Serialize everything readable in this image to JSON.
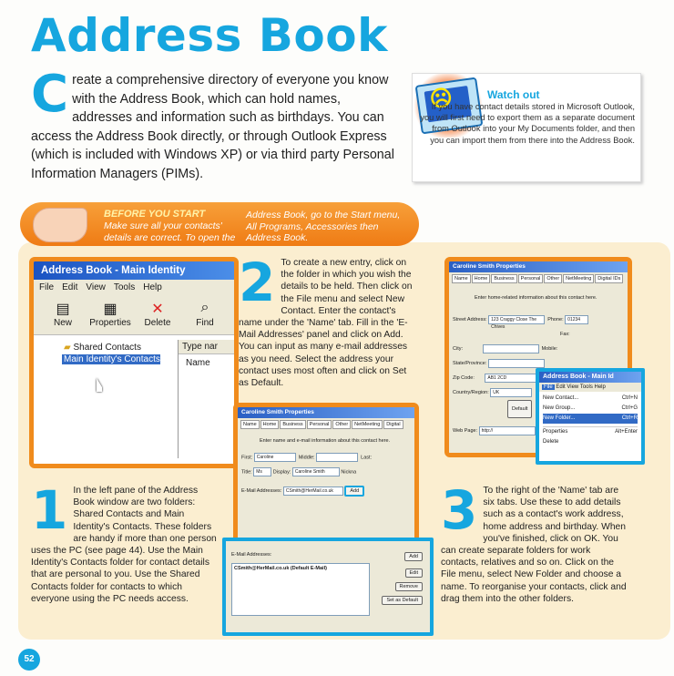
{
  "title": "Address Book",
  "intro": {
    "dropcap": "C",
    "text": "reate a comprehensive directory of everyone you know with the Address Book, which can hold names, addresses and information such as birthdays. You can access the Address Book directly, or through Outlook Express (which is included with Windows XP) or via third party Personal Information Managers (PIMs)."
  },
  "watch_out": {
    "title": "Watch out",
    "text": "If you have contact details stored in Microsoft Outlook, you will first need to export them as a separate document from Outlook into your My Documents folder, and then you can import them from there into the Address Book."
  },
  "before_you_start": {
    "heading": "BEFORE YOU START",
    "text_left": "Make sure all your contacts' details are correct. To open the",
    "text_right": "Address Book, go to the Start menu, All Programs, Accessories then Address Book."
  },
  "screenshot1": {
    "window_title": "Address Book - Main Identity",
    "menu": [
      "File",
      "Edit",
      "View",
      "Tools",
      "Help"
    ],
    "tools": [
      "New",
      "Properties",
      "Delete",
      "Find"
    ],
    "tree": [
      "Shared Contacts",
      "Main Identity's Contacts"
    ],
    "col_type": "Type nar",
    "col_name": "Name"
  },
  "step1": {
    "number": "1",
    "text": "In the left pane of the Address Book window are two folders: Shared Contacts and Main Identity's Contacts. These folders are handy if more than one person uses the PC (see page 44). Use the Main Identity's Contacts folder for contact details that are personal to you. Use the Shared Contacts folder for contacts to which everyone using the PC needs access."
  },
  "step2": {
    "number": "2",
    "text": "To create a new entry, click on the folder in which you wish the details to be held. Then click on the File menu and select New Contact. Enter the contact's name under the 'Name' tab. Fill in the 'E-Mail Addresses' panel and click on Add. You can input as many e-mail addresses as you need. Select the address your contact uses most often and click on Set as Default."
  },
  "screenshot2": {
    "window_title": "Caroline Smith Properties",
    "tabs": [
      "Name",
      "Home",
      "Business",
      "Personal",
      "Other",
      "NetMeeting",
      "Digital"
    ],
    "instruction": "Enter name and e-mail information about this contact here.",
    "first_label": "First:",
    "first_value": "Caroline",
    "middle_label": "Middle:",
    "last_label": "Last:",
    "title_label": "Title:",
    "title_value": "Ms",
    "display_label": "Display:",
    "display_value": "Caroline Smith",
    "nick_label": "Nickna",
    "email_label": "E-Mail Addresses:",
    "email_value": "CSmith@HerMail.co.uk",
    "add_button": "Add"
  },
  "screenshot2b": {
    "email_label": "E-Mail Addresses:",
    "entry": "CSmith@HerMail.co.uk (Default E-Mail)",
    "add": "Add",
    "edit": "Edit",
    "remove": "Remove",
    "set_default": "Set as Default"
  },
  "screenshot3": {
    "window_title": "Caroline Smith Properties",
    "tabs": [
      "Name",
      "Home",
      "Business",
      "Personal",
      "Other",
      "NetMeeting",
      "Digital IDs"
    ],
    "instruction": "Enter home-related information about this contact here.",
    "street_label": "Street Address:",
    "street_value": "123 Craggy Close The Chives",
    "phone_label": "Phone:",
    "phone_value": "01234",
    "fax_label": "Fax:",
    "mobile_label": "Mobile:",
    "city_label": "City:",
    "state_label": "State/Province:",
    "zip_label": "Zip Code:",
    "zip_value": "AB1 2CD",
    "country_label": "Country/Region:",
    "country_value": "UK",
    "default_check": "Default",
    "web_label": "Web Page:",
    "web_value": "http://"
  },
  "screenshot3b": {
    "window_title": "Address Book - Main Id",
    "menu": [
      "File",
      "Edit",
      "View",
      "Tools",
      "Help"
    ],
    "items": [
      {
        "label": "New Contact...",
        "shortcut": "Ctrl+N"
      },
      {
        "label": "New Group...",
        "shortcut": "Ctrl+G"
      },
      {
        "label": "New Folder...",
        "shortcut": "Ctrl+R"
      },
      {
        "label": "Properties",
        "shortcut": "Alt+Enter"
      },
      {
        "label": "Delete",
        "shortcut": ""
      }
    ]
  },
  "step3": {
    "number": "3",
    "text": "To the right of the 'Name' tab are six tabs. Use these to add details such as a contact's work address, home address and birthday. When you've finished, click on OK. You can create separate folders for work contacts, relatives and so on. Click on the File menu, select New Folder and choose a name. To reorganise your contacts, click and drag them into the other folders."
  },
  "page_number": "52",
  "colors": {
    "accent": "#16a6df",
    "orange": "#f08b1c",
    "cream": "#fbeed0"
  }
}
